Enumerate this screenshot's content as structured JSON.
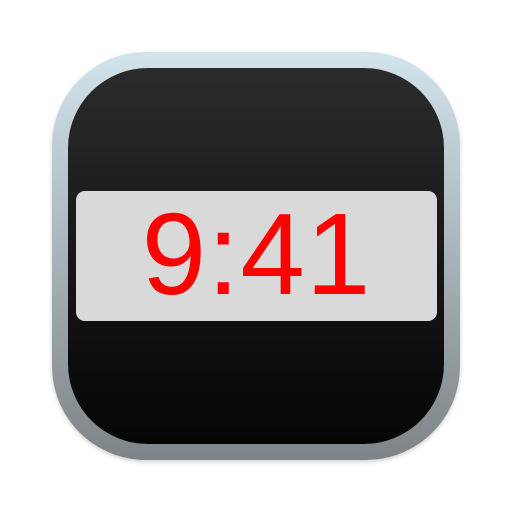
{
  "app_icon": {
    "name": "clock-display-icon",
    "display": {
      "time": "9:41",
      "digit_color": "#ff0000",
      "panel_color": "#d9d9d9"
    },
    "colors": {
      "face_dark": "#0a0a0a",
      "rim_light": "#d3e3ec",
      "rim_dark": "#7e8487"
    }
  }
}
